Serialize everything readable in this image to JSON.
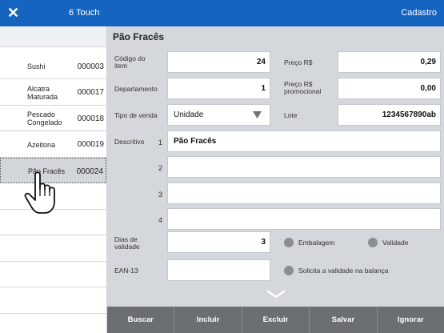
{
  "titlebar": {
    "close_icon": "close-icon",
    "app_name": "6 Touch",
    "section": "Cadastro"
  },
  "list": {
    "items": [
      {
        "name": "Sushi",
        "code": "000003",
        "selected": false
      },
      {
        "name": "Alcatra\nMaturada",
        "code": "000017",
        "selected": false
      },
      {
        "name": "Pescado\nCongelado",
        "code": "000018",
        "selected": false
      },
      {
        "name": "Azeitona",
        "code": "000019",
        "selected": false
      },
      {
        "name": "Pão Fracês",
        "code": "000024",
        "selected": true
      }
    ]
  },
  "form": {
    "title": "Pão Fracês",
    "codigo_label": "Código do\nitem",
    "codigo_value": "24",
    "preco_label": "Preço R$",
    "preco_value": "0,29",
    "departamento_label": "Departamento",
    "departamento_value": "1",
    "preco_promo_label": "Preço R$\npromocional",
    "preco_promo_value": "0,00",
    "tipo_venda_label": "Tipo de venda",
    "tipo_venda_value": "Unidade",
    "lote_label": "Lote",
    "lote_value": "1234567890ab",
    "descritivo_label": "Descritivo",
    "descritivo_lines": [
      {
        "num": "1",
        "value": "Pão Fracês"
      },
      {
        "num": "2",
        "value": ""
      },
      {
        "num": "3",
        "value": ""
      },
      {
        "num": "4",
        "value": ""
      }
    ],
    "dias_validade_label": "Dias de\nvalidade",
    "dias_validade_value": "3",
    "embalagem_label": "Embalagem",
    "validade_label": "Validade",
    "ean_label": "EAN-13",
    "ean_value": "",
    "solicita_label": "Solicita a validade na balança"
  },
  "buttons": {
    "buscar": "Buscar",
    "incluir": "Incluir",
    "excluir": "Excluir",
    "salvar": "Salvar",
    "ignorar": "Ignorar"
  }
}
